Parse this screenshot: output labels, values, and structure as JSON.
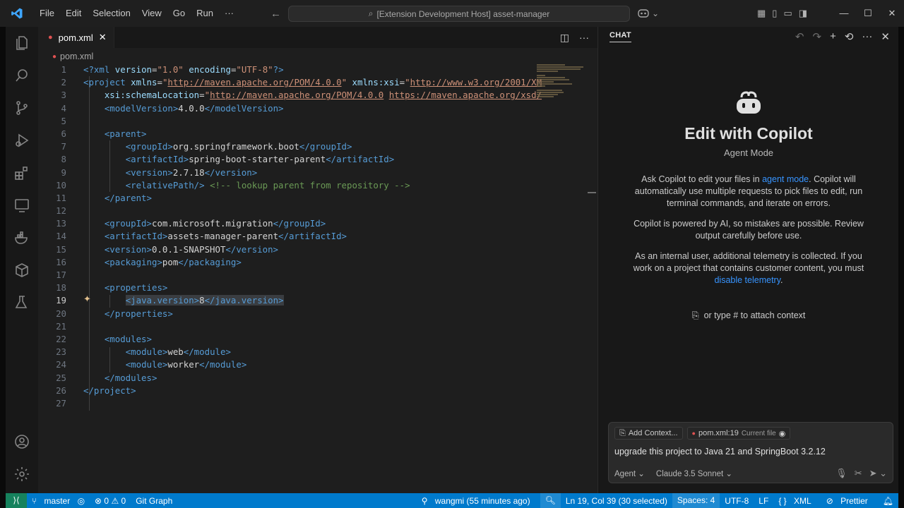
{
  "app": {
    "logo": "⌘",
    "menu": [
      "File",
      "Edit",
      "Selection",
      "View",
      "Go",
      "Run",
      "···"
    ],
    "command_center": "[Extension Development Host] asset-manager"
  },
  "activity_bar": [
    "explorer-icon",
    "search-icon",
    "source-control-icon",
    "run-debug-icon",
    "extensions-icon",
    "remote-explorer-icon",
    "docker-icon",
    "containers-icon",
    "testing-icon",
    "account-icon",
    "settings-gear-icon"
  ],
  "editor": {
    "tab": {
      "name": "pom.xml"
    },
    "breadcrumb": "pom.xml",
    "current_line": 19,
    "lines": [
      "1",
      "2",
      "3",
      "4",
      "5",
      "6",
      "7",
      "8",
      "9",
      "10",
      "11",
      "12",
      "13",
      "14",
      "15",
      "16",
      "17",
      "18",
      "19",
      "20",
      "21",
      "22",
      "23",
      "24",
      "25",
      "26",
      "27"
    ]
  },
  "chat": {
    "header": "CHAT",
    "title": "Edit with Copilot",
    "subtitle": "Agent Mode",
    "para1_prefix": "Ask Copilot to edit your files in ",
    "para1_link": "agent mode",
    "para1_suffix": ". Copilot will automatically use multiple requests to pick files to edit, run terminal commands, and iterate on errors.",
    "para2": "Copilot is powered by AI, so mistakes are possible. Review output carefully before use.",
    "para3_prefix": "As an internal user, additional telemetry is collected. If you work on a project that contains customer content, you must ",
    "para3_link": "disable telemetry",
    "para3_suffix": ".",
    "attach_hint": "or type # to attach context",
    "chip_add": "Add Context...",
    "chip_file": "pom.xml:19",
    "chip_file_note": "Current file",
    "prompt": "upgrade this project to Java 21 and SpringBoot 3.2.12",
    "mode": "Agent",
    "model": "Claude 3.5 Sonnet"
  },
  "status": {
    "branch": "master",
    "problems": "⊗ 0 ⚠ 0",
    "git_graph": "Git Graph",
    "blame": "wangmi (55 minutes ago)",
    "position": "Ln 19, Col 39 (30 selected)",
    "spaces": "Spaces: 4",
    "encoding": "UTF-8",
    "eol": "LF",
    "language": "XML",
    "prettier": "Prettier"
  },
  "colors": {
    "accent": "#007acc",
    "link": "#3794ff",
    "tag": "#569cd6",
    "attr": "#9cdcfe",
    "string": "#ce9178",
    "comment": "#6a9955"
  }
}
